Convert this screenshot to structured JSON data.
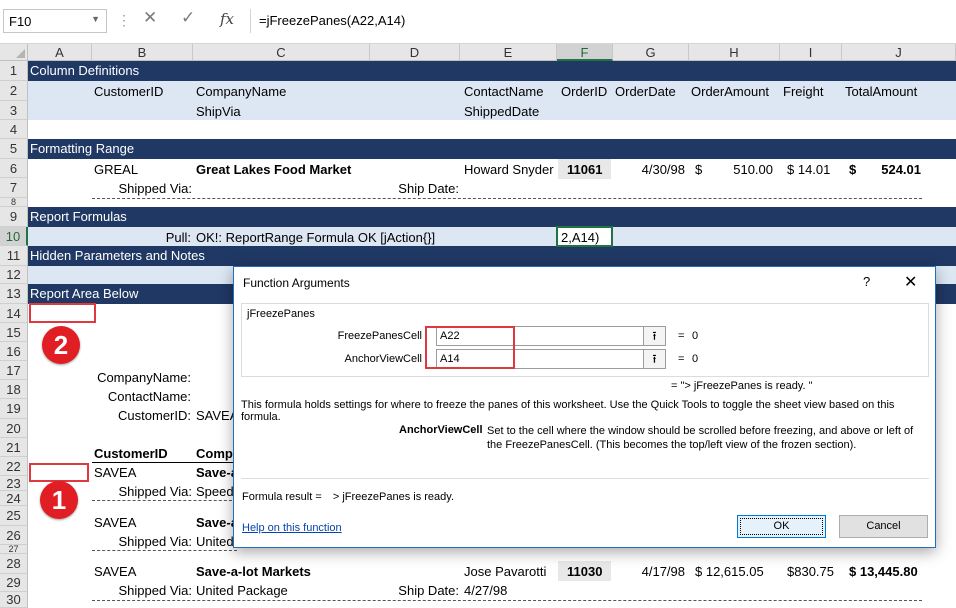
{
  "formula_bar": {
    "name_box": "F10",
    "formula": "=jFreezePanes(A22,A14)"
  },
  "icons": {
    "name_box_dropdown": "chevron-down-icon",
    "cancel": "close-icon",
    "enter": "check-icon",
    "insert_function": "fx-icon"
  },
  "columns": [
    "A",
    "B",
    "C",
    "D",
    "E",
    "F",
    "G",
    "H",
    "I",
    "J"
  ],
  "rows": [
    "1",
    "2",
    "3",
    "4",
    "5",
    "6",
    "7",
    "8",
    "9",
    "10",
    "11",
    "12",
    "13",
    "14",
    "15",
    "16",
    "17",
    "18",
    "19",
    "20",
    "21",
    "22",
    "23",
    "24",
    "25",
    "26",
    "27",
    "28",
    "29",
    "30"
  ],
  "sheet": {
    "section_column_definitions": "Column Definitions",
    "section_formatting_range": "Formatting Range",
    "section_report_formulas": "Report Formulas",
    "section_hidden_params": "Hidden Parameters and Notes",
    "section_report_area": "Report Area Below",
    "coldefs_row2": [
      "CustomerID",
      "CompanyName",
      "ContactName",
      "OrderID",
      "OrderDate",
      "OrderAmount",
      "Freight",
      "TotalAmount"
    ],
    "coldefs_row3": [
      "ShipVia",
      "ShippedDate"
    ],
    "fmt": {
      "customer_id": "GREAL",
      "company": "Great Lakes Food Market",
      "contact": "Howard Snyder",
      "order_id": "11061",
      "order_date": "4/30/98",
      "order_amount_cur": "$",
      "order_amount": "510.00",
      "freight": "$ 14.01",
      "total_cur": "$",
      "total": "524.01",
      "shipped_via_label": "Shipped Via:",
      "ship_date_label": "Ship Date:"
    },
    "pull_label": "Pull:",
    "pull_value": "OK!: ReportRange Formula OK [jAction{}]",
    "active_cell_text": "2,A14)",
    "header_block": {
      "company_label": "CompanyName:",
      "contact_label": "ContactName:",
      "customer_label": "CustomerID:",
      "customer_value": "SAVEA"
    },
    "table_headers": {
      "customer_id": "CustomerID",
      "company": "Comp"
    },
    "row22": {
      "customer_id": "SAVEA",
      "company": "Save-a"
    },
    "row23": {
      "label": "Shipped Via:",
      "value": "Speedy"
    },
    "row25": {
      "customer_id": "SAVEA",
      "company": "Save-a"
    },
    "row26": {
      "label": "Shipped Via:",
      "value": "United"
    },
    "row28": {
      "customer_id": "SAVEA",
      "company": "Save-a-lot Markets",
      "contact": "Jose Pavarotti",
      "order_id": "11030",
      "order_date": "4/17/98",
      "order_amount": "$  12,615.05",
      "freight": "$830.75",
      "total": "$  13,445.80"
    },
    "row29": {
      "label": "Shipped Via:",
      "value": "United Package",
      "date_label": "Ship Date:",
      "date_value": "4/27/98"
    }
  },
  "annotations": {
    "badge_1": "1",
    "badge_2": "2",
    "colors": {
      "badge": "#e01e24",
      "box": "#e0383e"
    }
  },
  "dialog": {
    "title": "Function Arguments",
    "help": "?",
    "close": "✕",
    "function_name": "jFreezePanes",
    "args": [
      {
        "label": "FreezePanesCell",
        "value": "A22",
        "equals": "=",
        "result": "0"
      },
      {
        "label": "AnchorViewCell",
        "value": "A14",
        "equals": "=",
        "result": "0"
      }
    ],
    "function_result": "=   \"> jFreezePanes is ready. \"",
    "description": "This formula holds settings for where to freeze the panes of this worksheet. Use the Quick Tools to toggle the sheet view based on this formula.",
    "arg_detail_name": "AnchorViewCell",
    "arg_detail_text": "Set to the cell where the window should be scrolled before freezing, and above or left of the FreezePanesCell. (This becomes the top/left view of the frozen section).",
    "formula_result_label": "Formula result =",
    "formula_result_value": "> jFreezePanes is ready.",
    "help_link": "Help on this function",
    "ok": "OK",
    "cancel": "Cancel",
    "ref_icon": "collapse-dialog-icon"
  },
  "colors": {
    "section_band": "#203864",
    "light_band": "#dde7f4",
    "selection": "#217346"
  }
}
